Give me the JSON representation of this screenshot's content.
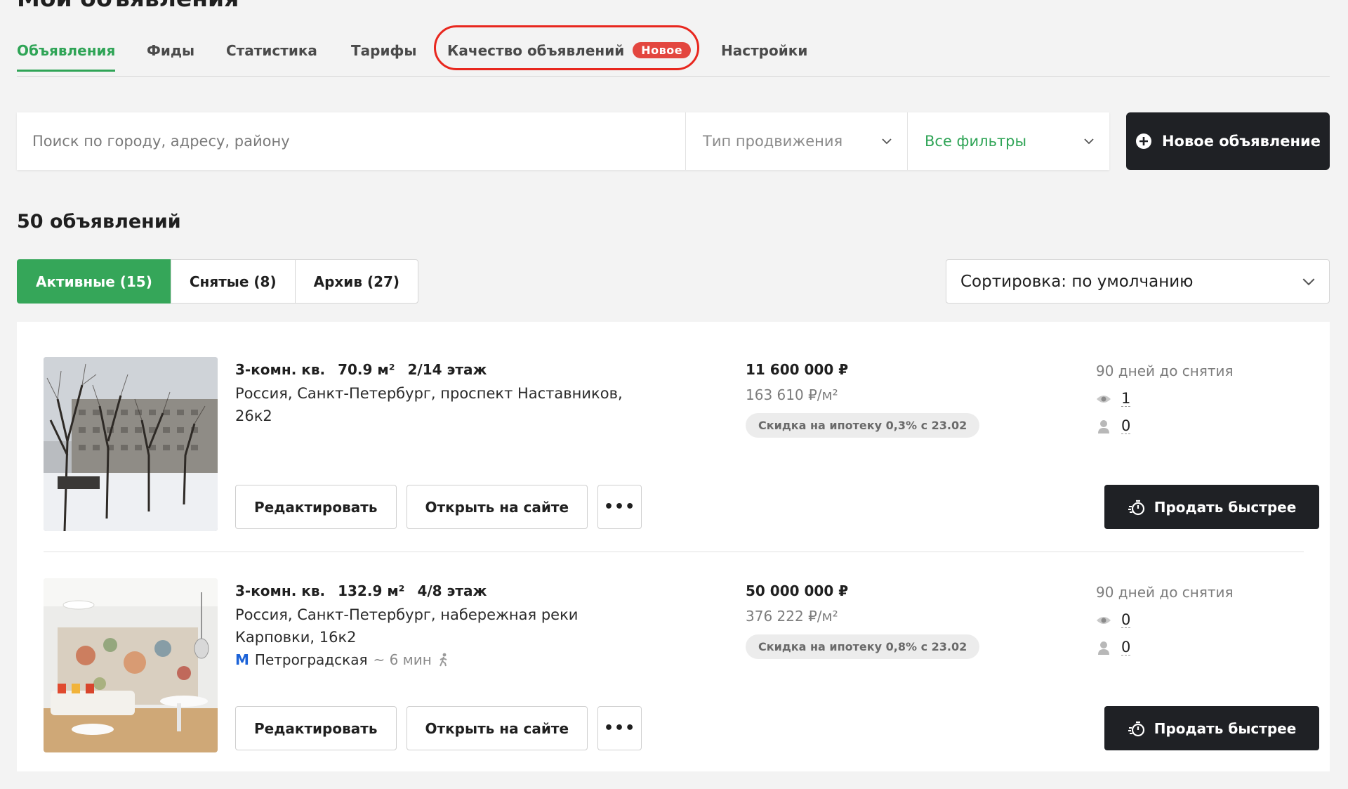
{
  "page": {
    "title": "Мои объявления"
  },
  "tabs": [
    {
      "label": "Объявления",
      "active": true
    },
    {
      "label": "Фиды"
    },
    {
      "label": "Статистика"
    },
    {
      "label": "Тарифы"
    },
    {
      "label": "Качество объявлений",
      "badge": "Новое"
    },
    {
      "label": "Настройки"
    }
  ],
  "search": {
    "placeholder": "Поиск по городу, адресу, району",
    "promotion_select": "Тип продвижения",
    "filters_select": "Все фильтры",
    "new_ad_label": "Новое объявление"
  },
  "listings_count": "50 объявлений",
  "status_tabs": [
    {
      "label": "Активные (15)",
      "active": true
    },
    {
      "label": "Снятые (8)"
    },
    {
      "label": "Архив (27)"
    }
  ],
  "sort": {
    "label": "Сортировка: по умолчанию"
  },
  "listings": [
    {
      "rooms": "3-комн. кв.",
      "area": "70.9 м²",
      "floor": "2/14 этаж",
      "address": "Россия, Санкт-Петербург, проспект Наставников, 26к2",
      "price": "11 600 000 ₽",
      "price_per_m2": "163 610 ₽/м²",
      "discount": "Скидка на ипотеку 0,3% с 23.02",
      "days_left": "90 дней до снятия",
      "views": "1",
      "contacts": "0",
      "edit_label": "Редактировать",
      "open_label": "Открыть на сайте",
      "more_label": "•••",
      "sell_label": "Продать быстрее"
    },
    {
      "rooms": "3-комн. кв.",
      "area": "132.9 м²",
      "floor": "4/8 этаж",
      "address": "Россия, Санкт-Петербург, набережная реки Карповки, 16к2",
      "metro": {
        "icon": "М",
        "station": "Петроградская",
        "time": "~ 6 мин"
      },
      "price": "50 000 000 ₽",
      "price_per_m2": "376 222 ₽/м²",
      "discount": "Скидка на ипотеку 0,8% с 23.02",
      "days_left": "90 дней до снятия",
      "views": "0",
      "contacts": "0",
      "edit_label": "Редактировать",
      "open_label": "Открыть на сайте",
      "more_label": "•••",
      "sell_label": "Продать быстрее"
    }
  ],
  "colors": {
    "accent": "#2fa456",
    "dark_button": "#1f2125",
    "badge": "#e3463f",
    "highlight_ring": "#e8271e",
    "metro": "#1c63d8"
  },
  "icons": [
    "plus-circle-icon",
    "chevron-down-icon",
    "eye-icon",
    "person-icon",
    "stopwatch-icon",
    "walk-icon",
    "metro-icon"
  ]
}
